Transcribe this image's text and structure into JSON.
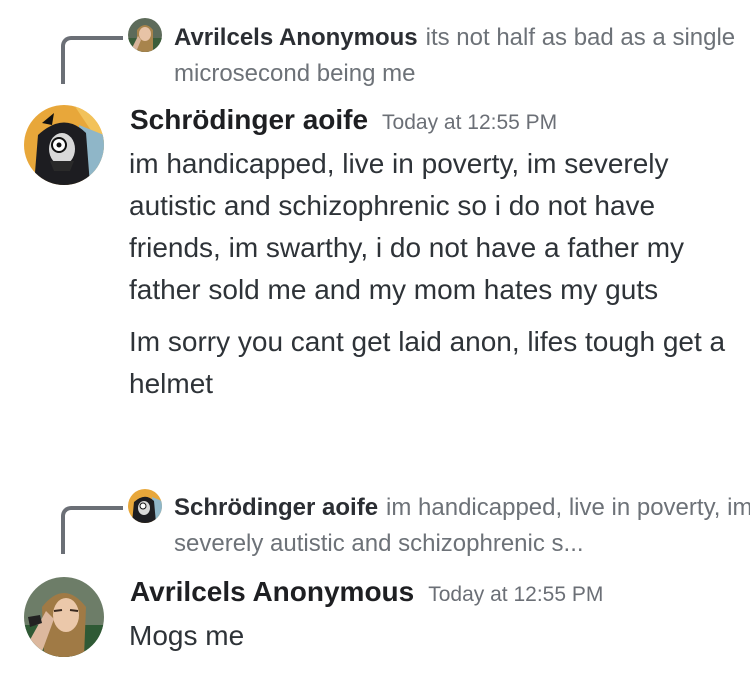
{
  "messages": [
    {
      "reply": {
        "name": "Avrilcels Anonymous",
        "preview": "its not half as bad as a single microsecond being me",
        "avatar_icon": "avril-avatar-icon"
      },
      "author": "Schrödinger aoife",
      "timestamp": "Today at 12:55 PM",
      "avatar_icon": "masked-figure-avatar-icon",
      "paragraphs": [
        "im handicapped, live in poverty, im severely autistic and schizophrenic so i do not have friends, im swarthy, i do not have a father my father sold me and my mom hates my guts",
        "Im sorry you cant get laid anon, lifes tough get a helmet"
      ]
    },
    {
      "reply": {
        "name": "Schrödinger aoife",
        "preview": "im handicapped, live in poverty, im severely autistic and schizophrenic s...",
        "avatar_icon": "masked-figure-avatar-icon"
      },
      "author": "Avrilcels Anonymous",
      "timestamp": "Today at 12:55 PM",
      "avatar_icon": "avril-avatar-icon",
      "paragraphs": [
        "Mogs me"
      ]
    }
  ]
}
